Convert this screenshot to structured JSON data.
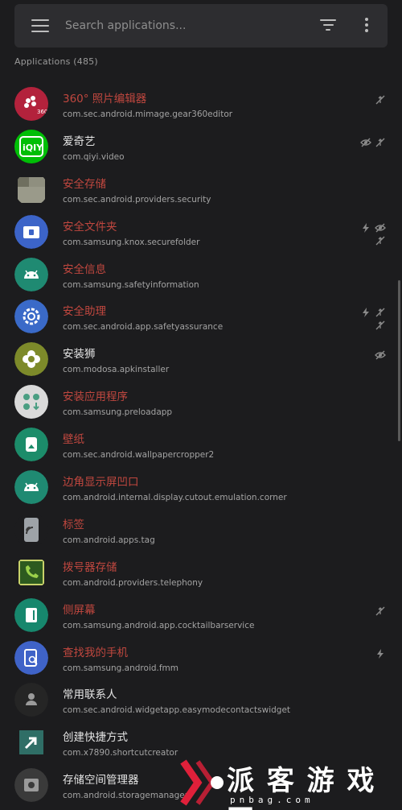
{
  "search": {
    "placeholder": "Search applications..."
  },
  "section": {
    "label": "Applications (485)"
  },
  "apps": [
    {
      "name": "360° 照片编辑器",
      "package": "com.sec.android.mimage.gear360editor",
      "disabled": true,
      "icon": "photo-editor-360-icon",
      "color": "#b3223c",
      "flags": [
        "no-internet"
      ]
    },
    {
      "name": "爱奇艺",
      "package": "com.qiyi.video",
      "disabled": false,
      "icon": "iqiyi-icon",
      "color": "#13a836",
      "flags": [
        "hidden",
        "no-internet"
      ]
    },
    {
      "name": "安全存储",
      "package": "com.sec.android.providers.security",
      "disabled": true,
      "icon": "security-storage-icon",
      "color": "#8a8a7a",
      "flags": []
    },
    {
      "name": "安全文件夹",
      "package": "com.samsung.knox.securefolder",
      "disabled": true,
      "icon": "secure-folder-icon",
      "color": "#3c64c8",
      "flags": [
        "boot",
        "hidden",
        "no-internet"
      ]
    },
    {
      "name": "安全信息",
      "package": "com.samsung.safetyinformation",
      "disabled": true,
      "icon": "android-icon",
      "color": "#1f8a72",
      "flags": []
    },
    {
      "name": "安全助理",
      "package": "com.sec.android.app.safetyassurance",
      "disabled": true,
      "icon": "safety-settings-icon",
      "color": "#3a6ac8",
      "flags": [
        "boot",
        "no-internet",
        "no-internet"
      ]
    },
    {
      "name": "安装狮",
      "package": "com.modosa.apkinstaller",
      "disabled": false,
      "icon": "apk-installer-icon",
      "color": "#7d8a2a",
      "flags": [
        "hidden"
      ]
    },
    {
      "name": "安装应用程序",
      "package": "com.samsung.preloadapp",
      "disabled": true,
      "icon": "preload-app-icon",
      "color": "#d7d7d7",
      "flags": []
    },
    {
      "name": "壁纸",
      "package": "com.sec.android.wallpapercropper2",
      "disabled": true,
      "icon": "wallpaper-icon",
      "color": "#1c8c6a",
      "flags": []
    },
    {
      "name": "边角显示屏凹口",
      "package": "com.android.internal.display.cutout.emulation.corner",
      "disabled": true,
      "icon": "android-icon",
      "color": "#1f8a72",
      "flags": []
    },
    {
      "name": "标签",
      "package": "com.android.apps.tag",
      "disabled": true,
      "icon": "tag-icon",
      "color": "#9ea3a8",
      "flags": []
    },
    {
      "name": "拨号器存储",
      "package": "com.android.providers.telephony",
      "disabled": true,
      "icon": "phone-icon",
      "color": "#2d6e2a",
      "flags": []
    },
    {
      "name": "侧屏幕",
      "package": "com.samsung.android.app.cocktailbarservice",
      "disabled": true,
      "icon": "edge-screen-icon",
      "color": "#17876d",
      "flags": [
        "no-internet"
      ]
    },
    {
      "name": "查找我的手机",
      "package": "com.samsung.android.fmm",
      "disabled": true,
      "icon": "find-my-mobile-icon",
      "color": "#3f63c8",
      "flags": [
        "boot"
      ]
    },
    {
      "name": "常用联系人",
      "package": "com.sec.android.widgetapp.easymodecontactswidget",
      "disabled": false,
      "icon": "contact-icon",
      "color": "#2a2a2a",
      "flags": []
    },
    {
      "name": "创建快捷方式",
      "package": "com.x7890.shortcutcreator",
      "disabled": false,
      "icon": "shortcut-icon",
      "color": "#2f6e66",
      "flags": []
    },
    {
      "name": "存储空间管理器",
      "package": "com.android.storagemanager",
      "disabled": false,
      "icon": "storage-manager-icon",
      "color": "#3a3a3a",
      "flags": []
    }
  ],
  "watermark": {
    "text": "派 客 游 戏 网",
    "url": "pnbag.com"
  },
  "colors": {
    "background": "#1c1c1e",
    "search_bar": "#2d2d30",
    "disabled_name": "#c0473f",
    "enabled_name": "#e4e4e4",
    "package_text": "#a3a3a3"
  }
}
